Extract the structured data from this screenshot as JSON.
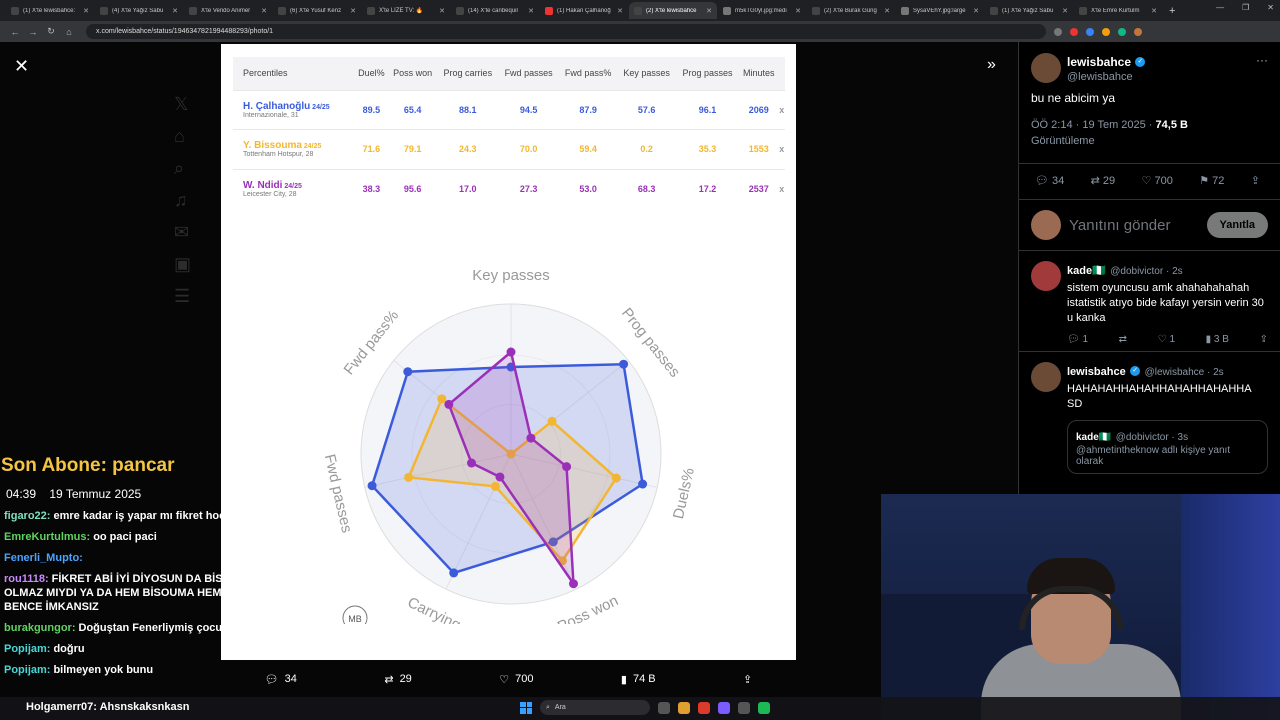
{
  "browser": {
    "tabs": [
      {
        "title": "(1) X'te lewisbahce:",
        "fav": "#444"
      },
      {
        "title": "(4) X'te Yağız Sabu",
        "fav": "#444"
      },
      {
        "title": "X'te Vendo Animer",
        "fav": "#444"
      },
      {
        "title": "(6) X'te Yusuf Kenz",
        "fav": "#444"
      },
      {
        "title": "X'te LİZE TV: 🔥",
        "fav": "#444"
      },
      {
        "title": "(14) X'te canbequil",
        "fav": "#444"
      },
      {
        "title": "(1) Hakan Çalhanoğ",
        "fav": "#e33"
      },
      {
        "title": "(2) X'te lewisbahce",
        "fav": "#444"
      },
      {
        "title": "m5kTG0yl.jpg:medi",
        "fav": "#777"
      },
      {
        "title": "(2) X'te Burak Güng",
        "fav": "#444"
      },
      {
        "title": "SysaVEhY.jpg:large",
        "fav": "#777"
      },
      {
        "title": "(1) X'te Yağız Sabu",
        "fav": "#444"
      },
      {
        "title": "X'te Emre Kurtulm",
        "fav": "#444"
      }
    ],
    "active_tab": 7,
    "url": "x.com/lewisbahce/status/1946347821994488293/photo/1"
  },
  "photo": {
    "table": {
      "header_label": "Percentiles",
      "columns": [
        "Duel%",
        "Poss won",
        "Prog carries",
        "Fwd passes",
        "Fwd pass%",
        "Key passes",
        "Prog passes",
        "Minutes"
      ],
      "rows": [
        {
          "name": "H. Çalhanoğlu",
          "season": "24/25",
          "club": "Internazionale, 31",
          "color": "#3b5bdb",
          "values": [
            "89.5",
            "65.4",
            "88.1",
            "94.5",
            "87.9",
            "57.6",
            "96.1",
            "2069"
          ],
          "x": "x"
        },
        {
          "name": "Y. Bissouma",
          "season": "24/25",
          "club": "Tottenham Hotspur, 28",
          "color": "#f2b632",
          "values": [
            "71.6",
            "79.1",
            "24.3",
            "70.0",
            "59.4",
            "0.2",
            "35.3",
            "1553"
          ],
          "x": "x"
        },
        {
          "name": "W. Ndidi",
          "season": "24/25",
          "club": "Leicester City, 28",
          "color": "#9b30b8",
          "values": [
            "38.3",
            "95.6",
            "17.0",
            "27.3",
            "53.0",
            "68.3",
            "17.2",
            "2537"
          ],
          "x": "x"
        }
      ]
    },
    "radar": {
      "axes": [
        "Key passes",
        "Prog passes",
        "Duels%",
        "Poss won",
        "Carrying",
        "Fwd passes",
        "Fwd pass%"
      ],
      "series": [
        {
          "name": "H. Çalhanoğlu",
          "color": "#3b5bdb",
          "values": [
            58,
            96,
            90,
            65,
            88,
            95,
            88
          ]
        },
        {
          "name": "Y. Bissouma",
          "color": "#f2b632",
          "values": [
            0,
            35,
            72,
            79,
            24,
            70,
            59
          ]
        },
        {
          "name": "W. Ndidi",
          "color": "#9b30b8",
          "values": [
            68,
            17,
            38,
            96,
            17,
            27,
            53
          ]
        }
      ],
      "watermark": "MB"
    }
  },
  "media_actions": {
    "replies": "34",
    "reposts": "29",
    "likes": "700",
    "views": "74 B"
  },
  "tweet": {
    "display_name": "lewisbahce",
    "handle": "@lewisbahce",
    "text": "bu ne abicim ya",
    "time": "ÖÖ 2:14 · 19 Tem 2025 · ",
    "views_count": "74,5 B",
    "views_label": "Görüntüleme",
    "stats": {
      "replies": "34",
      "reposts": "29",
      "likes": "700",
      "bookmarks": "72"
    },
    "reply_placeholder": "Yanıtını gönder",
    "reply_button": "Yanıtla"
  },
  "replies": [
    {
      "name": "kade🇳🇬",
      "handle": "@dobivictor · 2s",
      "text": "sistem oyuncusu amk ahahahahahah istatistik atıyo bide kafayı yersin verin 30 u kanka",
      "r": "1",
      "rt": "",
      "l": "1",
      "v": "3 B"
    },
    {
      "name": "lewisbahce",
      "handle": "@lewisbahce · 2s",
      "text": "HAHAHAHHAHAHHAHAHHAHAHHA SD",
      "quote_name": "kade🇳🇬",
      "quote_handle": "@dobivictor · 3s",
      "quote_text": "@ahmetintheknow adlı kişiye yanıt olarak"
    }
  ],
  "stream": {
    "last_sub": "Son Abone: pancar",
    "time": "04:39",
    "date": "19 Temmuz 2025",
    "chat": [
      {
        "user": "figaro22:",
        "color": "#7fe0c0",
        "msg": "emre kadar iş yapar mı fikret hocam"
      },
      {
        "user": "EmreKurtulmus:",
        "color": "#5fd35f",
        "msg": "oo paci paci"
      },
      {
        "user": "Fenerli_Mupto:",
        "color": "#4aa3ff",
        "msg": ""
      },
      {
        "user": "rou1118:",
        "color": "#c98bff",
        "msg": "FİKRET ABİ İYİ DİYOSUN DA BİSSOUMA DAHA İYİ OLMAZ MIYDI YA DA HEM BİSOUMA HEM HAKAN MI ALINIR BENCE İMKANSIZ"
      },
      {
        "user": "burakgungor:",
        "color": "#5fd35f",
        "msg": "Doğuştan Fenerliymiş çocuk"
      },
      {
        "user": "Popijam:",
        "color": "#4ad6d6",
        "msg": "doğru"
      },
      {
        "user": "Popijam:",
        "color": "#4ad6d6",
        "msg": "bilmeyen yok bunu"
      }
    ],
    "taskbar_chat": "Holgamerr07: Ahsnskaksnkasn"
  },
  "taskbar": {
    "search": "Ara"
  }
}
